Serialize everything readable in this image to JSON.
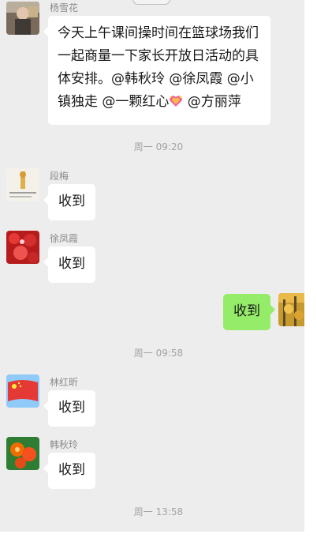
{
  "messages": [
    {
      "sender": "杨雪花",
      "text": "今天上午课间操时间在篮球场我们一起商量一下家长开放日活动的具体安排。@韩秋玲 @徐凤霞 @小镇独走 @一颗红心",
      "text_tail": " @方丽萍"
    },
    {
      "sender": "段梅",
      "text": "收到"
    },
    {
      "sender": "徐凤霞",
      "text": "收到"
    },
    {
      "sender": "",
      "text": "收到",
      "self": true
    },
    {
      "sender": "林红昕",
      "text": "收到"
    },
    {
      "sender": "韩秋玲",
      "text": "收到"
    }
  ],
  "timestamps": [
    "周一 09:20",
    "周一 09:58",
    "周一 13:58"
  ],
  "colors": {
    "background": "#ededed",
    "incoming_bubble": "#ffffff",
    "outgoing_bubble": "#95ec69",
    "sender_name": "#8a8a8a",
    "timestamp": "#a3a3a3"
  },
  "icons": {
    "heart_emoji": "sparkling-heart-icon"
  }
}
